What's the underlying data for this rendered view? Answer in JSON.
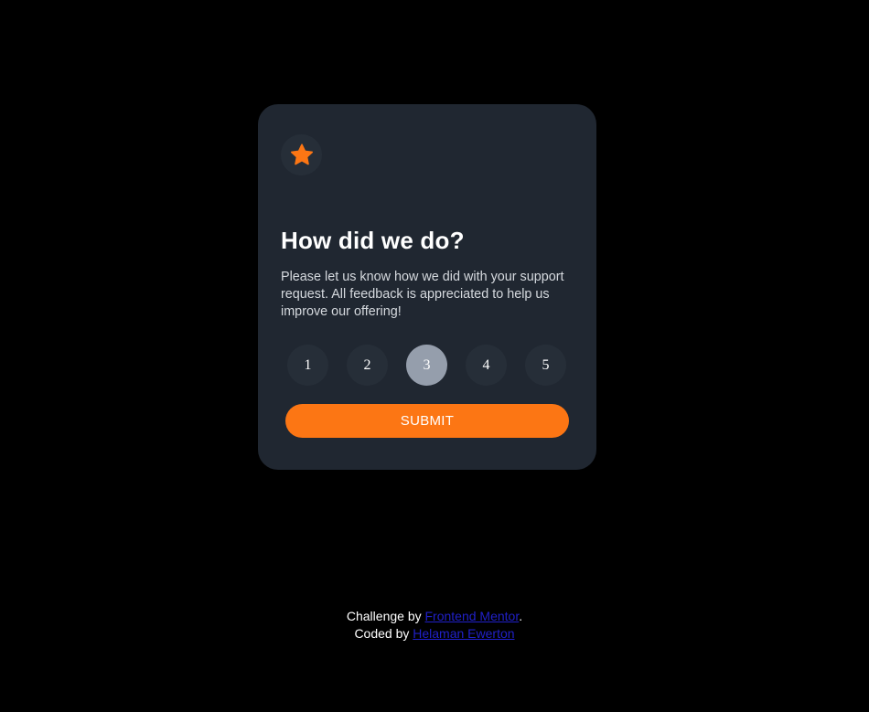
{
  "card": {
    "icon": "star-icon",
    "title": "How did we do?",
    "description": "Please let us know how we did with your support request. All feedback is appreciated to help us improve our offering!",
    "ratings": [
      "1",
      "2",
      "3",
      "4",
      "5"
    ],
    "selected_rating": "3",
    "submit_label": "SUBMIT"
  },
  "attribution": {
    "challenge_prefix": "Challenge by ",
    "challenge_link": "Frontend Mentor",
    "challenge_suffix": ".",
    "coded_prefix": "Coded by ",
    "coded_link": "Helaman Ewerton"
  },
  "colors": {
    "background": "#000000",
    "card": "#202731",
    "accent": "#fc7614",
    "selected": "#959eac",
    "circle": "#262e38",
    "link": "#2020c8"
  }
}
